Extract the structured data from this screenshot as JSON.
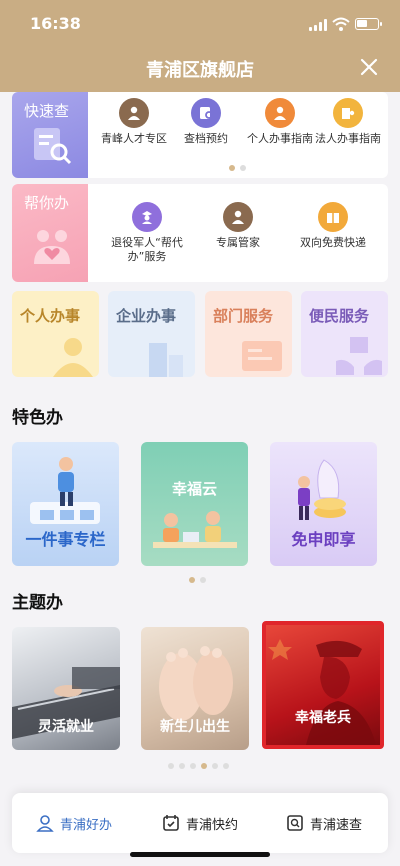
{
  "status": {
    "time": "16:38"
  },
  "header": {
    "title": "青浦区旗舰店"
  },
  "quick_check": {
    "label": "快速查",
    "items": [
      {
        "label": "青峰人才专区",
        "icon": "person-tie-icon"
      },
      {
        "label": "查档预约",
        "icon": "file-search-icon"
      },
      {
        "label": "个人办事指南",
        "icon": "person-icon"
      },
      {
        "label": "法人办事指南",
        "icon": "company-person-icon"
      }
    ]
  },
  "help_do": {
    "label": "帮你办",
    "items": [
      {
        "label": "退役军人“帮代办”服务",
        "icon": "veteran-icon"
      },
      {
        "label": "专属管家",
        "icon": "butler-icon"
      },
      {
        "label": "双向免费快递",
        "icon": "package-icon"
      }
    ]
  },
  "categories": [
    {
      "label": "个人办事",
      "bg": "#fdf0c6",
      "fg": "#b8862a"
    },
    {
      "label": "企业办事",
      "bg": "#e6eef9",
      "fg": "#5a6d8a"
    },
    {
      "label": "部门服务",
      "bg": "#fde6dc",
      "fg": "#d9805b"
    },
    {
      "label": "便民服务",
      "bg": "#ede4fa",
      "fg": "#7a5bb8"
    }
  ],
  "featured": {
    "title": "特色办",
    "tiles": [
      {
        "label": "一件事专栏"
      },
      {
        "label": "幸福云"
      },
      {
        "label": "免申即享"
      }
    ]
  },
  "themes": {
    "title": "主题办",
    "tiles": [
      {
        "label": "灵活就业"
      },
      {
        "label": "新生儿出生"
      },
      {
        "label": "幸福老兵"
      }
    ]
  },
  "tabs": [
    {
      "label": "青浦好办",
      "icon": "person-outline-icon",
      "active": true
    },
    {
      "label": "青浦快约",
      "icon": "calendar-check-icon",
      "active": false
    },
    {
      "label": "青浦速查",
      "icon": "search-doc-icon",
      "active": false
    }
  ],
  "colors": {
    "brand": "#c9ad84",
    "active_tab": "#3b6fc4",
    "highlight_border": "#e0262b"
  }
}
